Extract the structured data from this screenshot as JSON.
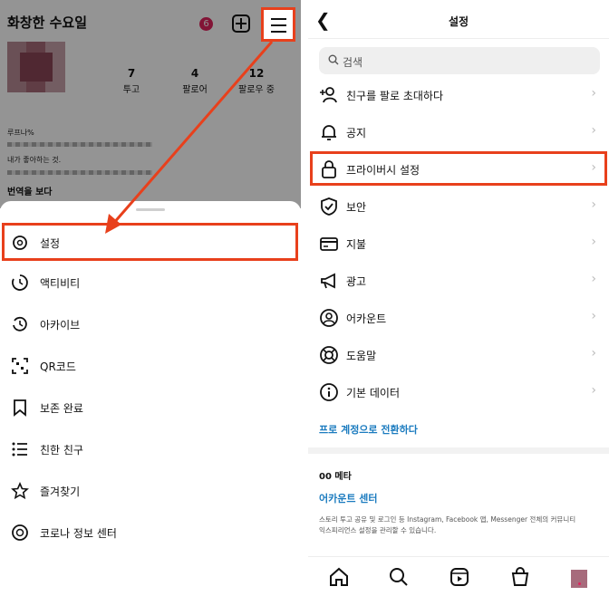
{
  "profile": {
    "username": "화창한 수요일",
    "notification_count": "6",
    "stats": [
      {
        "number": "7",
        "label": "투고"
      },
      {
        "number": "4",
        "label": "팔로어"
      },
      {
        "number": "12",
        "label": "팔로우 중"
      }
    ],
    "bio_line1": "루프나%",
    "bio_line2": "내가 좋아하는 것.",
    "translate_label": "번역을 보다"
  },
  "sheet": {
    "items": [
      {
        "label": "설정",
        "icon": "settings-gear-icon"
      },
      {
        "label": "액티비티",
        "icon": "activity-icon"
      },
      {
        "label": "아카이브",
        "icon": "archive-icon"
      },
      {
        "label": "QR코드",
        "icon": "qr-code-icon"
      },
      {
        "label": "보존 완료",
        "icon": "bookmark-icon"
      },
      {
        "label": "친한 친구",
        "icon": "close-friends-icon"
      },
      {
        "label": "즐겨찾기",
        "icon": "star-icon"
      },
      {
        "label": "코로나 정보 센터",
        "icon": "info-center-icon"
      }
    ]
  },
  "settings": {
    "title": "설정",
    "search_placeholder": "검색",
    "rows": [
      {
        "label": "친구를 팔로 초대하다",
        "icon": "add-person-icon"
      },
      {
        "label": "공지",
        "icon": "bell-icon"
      },
      {
        "label": "프라이버시 설정",
        "icon": "lock-icon"
      },
      {
        "label": "보안",
        "icon": "shield-icon"
      },
      {
        "label": "지불",
        "icon": "card-icon"
      },
      {
        "label": "광고",
        "icon": "megaphone-icon"
      },
      {
        "label": "어카운트",
        "icon": "account-icon"
      },
      {
        "label": "도움말",
        "icon": "lifebuoy-icon"
      },
      {
        "label": "기본 데이터",
        "icon": "info-icon"
      }
    ],
    "pro_link": "프로 계정으로 전환하다",
    "meta_title": "00 메타",
    "meta_link": "어카운트 센터",
    "meta_desc": "스토리 투고 공유 및 로그인 등 Instagram, Facebook 앱, Messenger 전체의 커뮤니티 익스피리언스 설정을 관리할 수 있습니다."
  },
  "colors": {
    "highlight": "#e8401c",
    "link": "#1b7bbf",
    "badge": "#e0245e"
  }
}
